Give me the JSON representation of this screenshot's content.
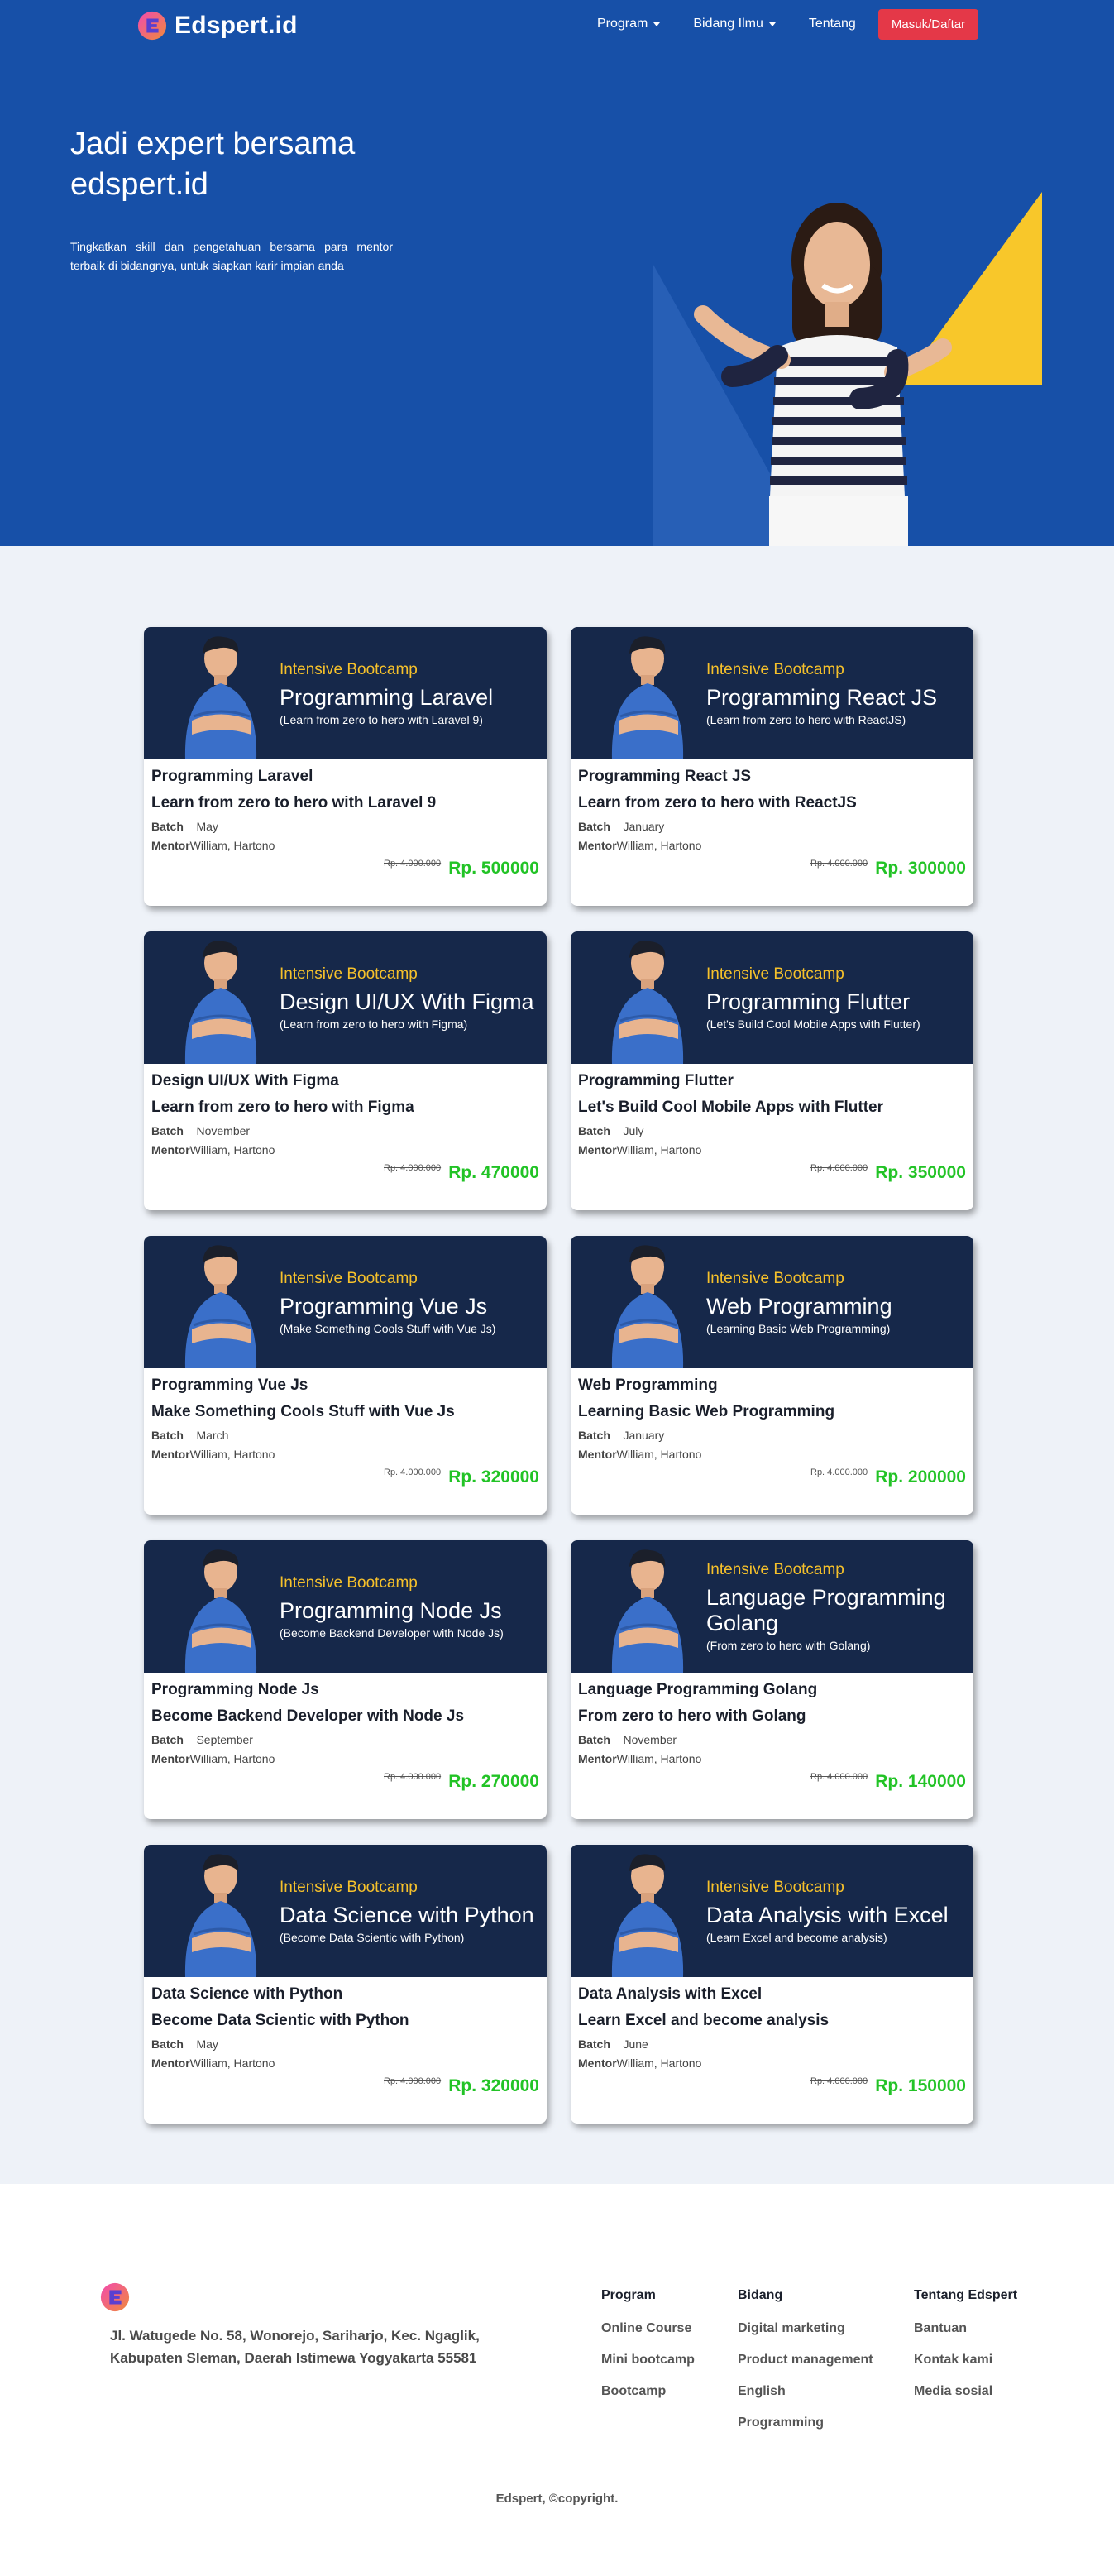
{
  "colors": {
    "hero_bg": "#1750a8",
    "card_banner": "#16284a",
    "accent_yellow": "#f6c12b",
    "price_green": "#22c326",
    "login_red": "#e43848"
  },
  "nav": {
    "brand": "Edspert.id",
    "links": [
      {
        "label": "Program",
        "dropdown": true
      },
      {
        "label": "Bidang Ilmu",
        "dropdown": true
      },
      {
        "label": "Tentang",
        "dropdown": false
      }
    ],
    "login": "Masuk/Daftar"
  },
  "hero": {
    "title": "Jadi expert bersama edspert.id",
    "subtitle": "Tingkatkan skill dan pengetahuan bersama para mentor terbaik di bidangnya, untuk siapkan karir impian anda"
  },
  "courses": [
    {
      "tag": "Intensive Bootcamp",
      "banner_title": "Programming Laravel",
      "banner_sub": "(Learn from zero to hero with Laravel 9)",
      "name": "Programming Laravel",
      "desc": "Learn from zero to hero with Laravel 9",
      "batch_label": "Batch",
      "batch": "May",
      "mentor_label": "Mentor",
      "mentor": "William, Hartono",
      "old_price": "Rp. 4.000.000",
      "price": "Rp. 500000"
    },
    {
      "tag": "Intensive Bootcamp",
      "banner_title": "Programming React JS",
      "banner_sub": "(Learn from zero to hero with ReactJS)",
      "name": "Programming React JS",
      "desc": "Learn from zero to hero with ReactJS",
      "batch_label": "Batch",
      "batch": "January",
      "mentor_label": "Mentor",
      "mentor": "William, Hartono",
      "old_price": "Rp. 4.000.000",
      "price": "Rp. 300000"
    },
    {
      "tag": "Intensive Bootcamp",
      "banner_title": "Design UI/UX With Figma",
      "banner_sub": "(Learn from zero to hero with Figma)",
      "name": "Design UI/UX With Figma",
      "desc": "Learn from zero to hero with Figma",
      "batch_label": "Batch",
      "batch": "November",
      "mentor_label": "Mentor",
      "mentor": "William, Hartono",
      "old_price": "Rp. 4.000.000",
      "price": "Rp. 470000"
    },
    {
      "tag": "Intensive Bootcamp",
      "banner_title": "Programming Flutter",
      "banner_sub": "(Let's Build Cool Mobile Apps with Flutter)",
      "name": "Programming Flutter",
      "desc": "Let's Build Cool Mobile Apps with Flutter",
      "batch_label": "Batch",
      "batch": "July",
      "mentor_label": "Mentor",
      "mentor": "William, Hartono",
      "old_price": "Rp. 4.000.000",
      "price": "Rp. 350000"
    },
    {
      "tag": "Intensive Bootcamp",
      "banner_title": "Programming Vue Js",
      "banner_sub": "(Make Something Cools Stuff with Vue Js)",
      "name": "Programming Vue Js",
      "desc": "Make Something Cools Stuff with Vue Js",
      "batch_label": "Batch",
      "batch": "March",
      "mentor_label": "Mentor",
      "mentor": "William, Hartono",
      "old_price": "Rp. 4.000.000",
      "price": "Rp. 320000"
    },
    {
      "tag": "Intensive Bootcamp",
      "banner_title": "Web Programming",
      "banner_sub": "(Learning Basic Web Programming)",
      "name": "Web Programming",
      "desc": "Learning Basic Web Programming",
      "batch_label": "Batch",
      "batch": "January",
      "mentor_label": "Mentor",
      "mentor": "William, Hartono",
      "old_price": "Rp. 4.000.000",
      "price": "Rp. 200000"
    },
    {
      "tag": "Intensive Bootcamp",
      "banner_title": "Programming Node Js",
      "banner_sub": "(Become Backend Developer with Node Js)",
      "name": "Programming Node Js",
      "desc": "Become Backend Developer with Node Js",
      "batch_label": "Batch",
      "batch": "September",
      "mentor_label": "Mentor",
      "mentor": "William, Hartono",
      "old_price": "Rp. 4.000.000",
      "price": "Rp. 270000"
    },
    {
      "tag": "Intensive Bootcamp",
      "banner_title": "Language Programming Golang",
      "banner_sub": "(From zero to hero with Golang)",
      "name": "Language Programming Golang",
      "desc": "From zero to hero with Golang",
      "batch_label": "Batch",
      "batch": "November",
      "mentor_label": "Mentor",
      "mentor": "William, Hartono",
      "old_price": "Rp. 4.000.000",
      "price": "Rp. 140000"
    },
    {
      "tag": "Intensive Bootcamp",
      "banner_title": "Data Science with Python",
      "banner_sub": "(Become Data Scientic with Python)",
      "name": "Data Science with Python",
      "desc": "Become Data Scientic with Python",
      "batch_label": "Batch",
      "batch": "May",
      "mentor_label": "Mentor",
      "mentor": "William, Hartono",
      "old_price": "Rp. 4.000.000",
      "price": "Rp. 320000"
    },
    {
      "tag": "Intensive Bootcamp",
      "banner_title": "Data Analysis with Excel",
      "banner_sub": "(Learn Excel and become analysis)",
      "name": "Data Analysis with Excel",
      "desc": "Learn Excel and become analysis",
      "batch_label": "Batch",
      "batch": "June",
      "mentor_label": "Mentor",
      "mentor": "William, Hartono",
      "old_price": "Rp. 4.000.000",
      "price": "Rp. 150000"
    }
  ],
  "footer": {
    "address": "Jl. Watugede No. 58, Wonorejo, Sariharjo, Kec. Ngaglik, Kabupaten Sleman, Daerah Istimewa Yogyakarta 55581",
    "columns": [
      {
        "title": "Program",
        "items": [
          "Online Course",
          "Mini bootcamp",
          "Bootcamp"
        ]
      },
      {
        "title": "Bidang",
        "items": [
          "Digital marketing",
          "Product management",
          "English",
          "Programming"
        ]
      },
      {
        "title": "Tentang Edspert",
        "items": [
          "Bantuan",
          "Kontak kami",
          "Media sosial"
        ]
      }
    ],
    "copyright": "Edspert, ©copyright."
  }
}
